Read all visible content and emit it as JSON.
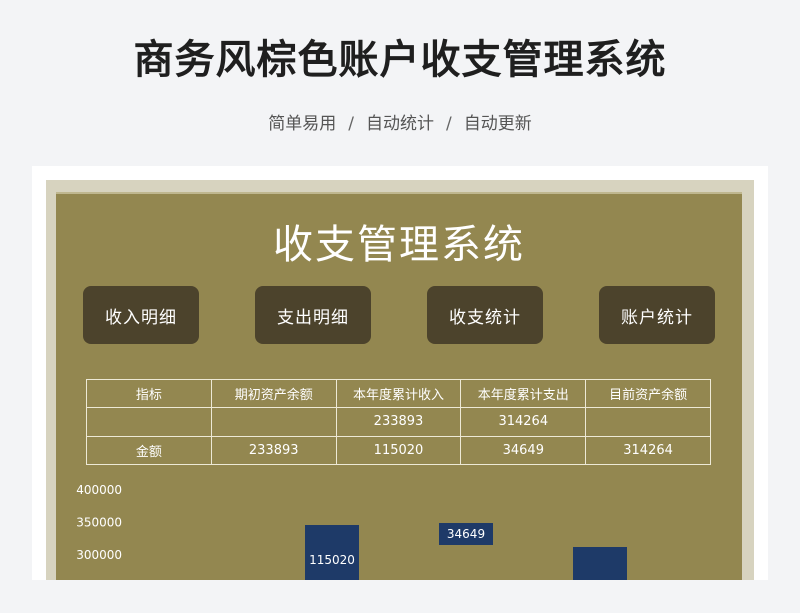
{
  "header": {
    "title": "商务风棕色账户收支管理系统",
    "features": [
      "简单易用",
      "自动统计",
      "自动更新"
    ],
    "separator": "/"
  },
  "sheet": {
    "title": "收支管理系统",
    "buttons": [
      "收入明细",
      "支出明细",
      "收支统计",
      "账户统计"
    ]
  },
  "summary_table": {
    "headers": [
      "指标",
      "期初资产余额",
      "本年度累计收入",
      "本年度累计支出",
      "目前资产余额"
    ],
    "rows": [
      [
        "",
        "",
        "233893",
        "314264",
        ""
      ],
      [
        "金额",
        "233893",
        "115020",
        "34649",
        "314264"
      ]
    ]
  },
  "chart_data": {
    "type": "bar",
    "ylim": [
      300000,
      400000
    ],
    "yticks": [
      400000,
      350000,
      300000
    ],
    "values": [
      115020,
      34649,
      314264
    ],
    "data_labels": [
      "115020",
      "34649",
      ""
    ],
    "bar_color": "#1e3a68"
  },
  "colors": {
    "sheet_background": "#938750",
    "button_background": "#4c432c",
    "bar": "#1e3a68"
  }
}
